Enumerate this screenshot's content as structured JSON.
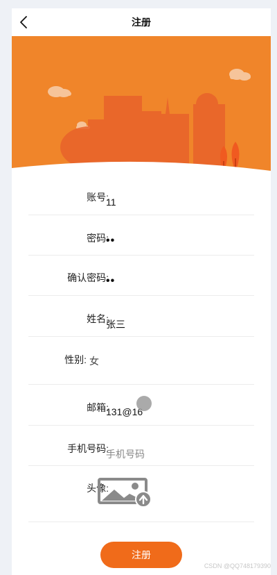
{
  "header": {
    "title": "注册"
  },
  "form": {
    "account": {
      "label": "账号:",
      "value": "11"
    },
    "password": {
      "label": "密码:",
      "value": "••"
    },
    "confirm": {
      "label": "确认密码:",
      "value": "••"
    },
    "name": {
      "label": "姓名:",
      "value": "张三"
    },
    "gender": {
      "label": "性别:",
      "value": "女"
    },
    "email": {
      "label": "邮箱:",
      "value": "131@16"
    },
    "phone": {
      "label": "手机号码:",
      "placeholder": "手机号码"
    },
    "avatar": {
      "label": "头像:"
    }
  },
  "submit_label": "注册",
  "watermark": "CSDN @QQ748179390",
  "colors": {
    "banner": "#f0852a",
    "button": "#f06b1a"
  }
}
